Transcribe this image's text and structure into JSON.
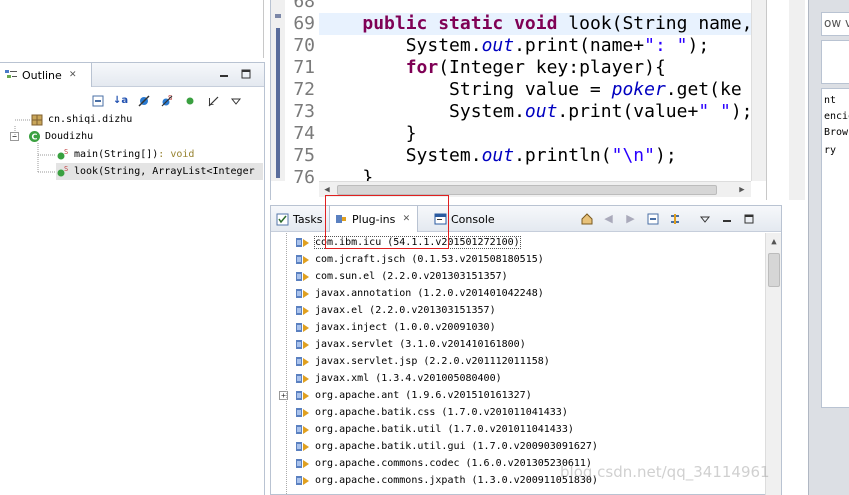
{
  "colors": {
    "keyword": "#7f0055",
    "field": "#0000c0",
    "string": "#2a00ff",
    "current_line": "#e8f2fe",
    "highlight_box": "#e02020"
  },
  "outline": {
    "tab_label": "Outline",
    "close_glyph": "✕",
    "tree": [
      {
        "label": "cn.shiqi.dizhu",
        "icon": "package-icon"
      },
      {
        "label": "Doudizhu",
        "icon": "class-icon"
      },
      {
        "label": "main(String[])",
        "suffix": " : void",
        "icon": "static-method-icon"
      },
      {
        "label": "look(String, ArrayList<Integer",
        "icon": "static-method-icon",
        "selected": true
      }
    ]
  },
  "editor": {
    "line_numbers": [
      "68",
      "69",
      "70",
      "71",
      "72",
      "73",
      "74",
      "75",
      "76"
    ],
    "lines": [
      {
        "indent": "",
        "parts": []
      },
      {
        "indent": "    ",
        "parts": [
          {
            "t": "public static void",
            "c": "kw"
          },
          {
            "t": " look(String name,"
          }
        ]
      },
      {
        "indent": "        ",
        "parts": [
          {
            "t": "System."
          },
          {
            "t": "out",
            "c": "fld"
          },
          {
            "t": ".print(name+"
          },
          {
            "t": "\": \"",
            "c": "str"
          },
          {
            "t": ");"
          }
        ]
      },
      {
        "indent": "        ",
        "parts": [
          {
            "t": "for",
            "c": "kw"
          },
          {
            "t": "(Integer key:player){"
          }
        ]
      },
      {
        "indent": "            ",
        "parts": [
          {
            "t": "String value = "
          },
          {
            "t": "poker",
            "c": "fld"
          },
          {
            "t": ".get(ke"
          }
        ]
      },
      {
        "indent": "            ",
        "parts": [
          {
            "t": "System."
          },
          {
            "t": "out",
            "c": "fld"
          },
          {
            "t": ".print(value+"
          },
          {
            "t": "\" \"",
            "c": "str"
          },
          {
            "t": ");"
          }
        ]
      },
      {
        "indent": "        ",
        "parts": [
          {
            "t": "}"
          }
        ]
      },
      {
        "indent": "        ",
        "parts": [
          {
            "t": "System."
          },
          {
            "t": "out",
            "c": "fld"
          },
          {
            "t": ".println("
          },
          {
            "t": "\"\\n\"",
            "c": "str"
          },
          {
            "t": ");"
          }
        ]
      },
      {
        "indent": "    ",
        "parts": [
          {
            "t": "}"
          }
        ]
      }
    ]
  },
  "bottom": {
    "tabs": [
      {
        "label": "Tasks",
        "icon": "tasks-icon"
      },
      {
        "label": "Plug-ins",
        "icon": "plugins-icon",
        "active": true
      },
      {
        "label": "Console",
        "icon": "console-icon"
      }
    ],
    "plugins": [
      {
        "id": "com.ibm.icu",
        "version": "(54.1.1.v201501272100)",
        "selected": true
      },
      {
        "id": "com.jcraft.jsch",
        "version": "(0.1.53.v201508180515)"
      },
      {
        "id": "com.sun.el",
        "version": "(2.2.0.v201303151357)"
      },
      {
        "id": "javax.annotation",
        "version": "(1.2.0.v201401042248)"
      },
      {
        "id": "javax.el",
        "version": "(2.2.0.v201303151357)"
      },
      {
        "id": "javax.inject",
        "version": "(1.0.0.v20091030)"
      },
      {
        "id": "javax.servlet",
        "version": "(3.1.0.v201410161800)"
      },
      {
        "id": "javax.servlet.jsp",
        "version": "(2.2.0.v201112011158)"
      },
      {
        "id": "javax.xml",
        "version": "(1.3.4.v201005080400)"
      },
      {
        "id": "org.apache.ant",
        "version": "(1.9.6.v201510161327)",
        "expandable": true
      },
      {
        "id": "org.apache.batik.css",
        "version": "(1.7.0.v201011041433)"
      },
      {
        "id": "org.apache.batik.util",
        "version": "(1.7.0.v201011041433)"
      },
      {
        "id": "org.apache.batik.util.gui",
        "version": "(1.7.0.v200903091627)"
      },
      {
        "id": "org.apache.commons.codec",
        "version": "(1.6.0.v201305230611)"
      },
      {
        "id": "org.apache.commons.jxpath",
        "version": "(1.3.0.v200911051830)"
      }
    ]
  },
  "right_panel": {
    "top_text": "ow v",
    "lines": [
      "nt",
      "encie",
      "Brows",
      "ry"
    ]
  },
  "watermark": "blog.csdn.net/qq_34114961"
}
